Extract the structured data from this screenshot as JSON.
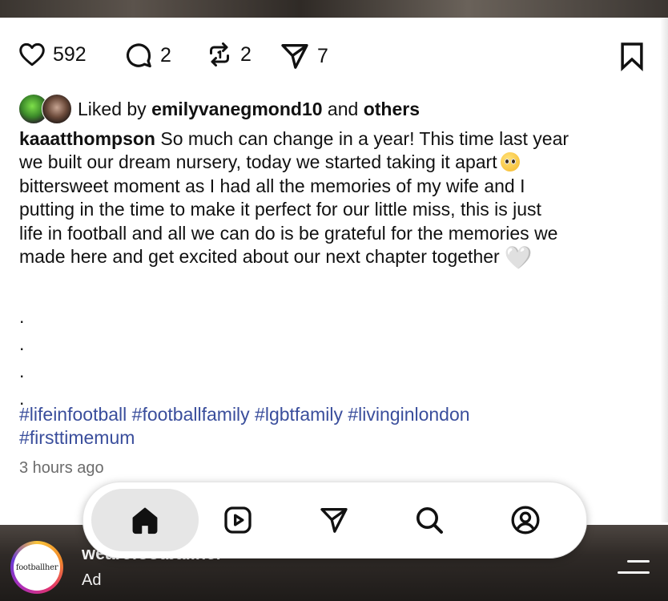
{
  "post": {
    "likes_count": "592",
    "comments_count": "2",
    "reposts_count": "2",
    "shares_count": "7",
    "liked_by_prefix": "Liked by",
    "liked_by_user": "emilyvanegmond10",
    "liked_by_and": "and",
    "liked_by_others": "others",
    "author": "kaaatthompson",
    "caption_line1": "So much can change in a year! This time last year",
    "caption_line2": "we built our dream nursery, today we started taking it apart",
    "caption_line3": "bittersweet moment as I had all the memories of my wife and I",
    "caption_line4": "putting in the time to make it perfect for our little miss, this is just",
    "caption_line5": "life in football and all we can do is be grateful for the memories we",
    "caption_line6": "made here and get excited about our next chapter together",
    "emoji_pleading": "pleading-face-emoji",
    "emoji_heart": "🤍",
    "dots": [
      ".",
      ".",
      ".",
      "."
    ],
    "hashtags_line1": "#lifeinfootball #footballfamily #lgbtfamily #livinginlondon",
    "hashtags_line2": "#firsttimemum",
    "timestamp": "3 hours ago"
  },
  "ad": {
    "logo_text": "footballher",
    "account_name": "wearefootballher",
    "label": "Ad"
  },
  "nav": {
    "items": [
      "home-icon",
      "reels-icon",
      "send-icon",
      "search-icon",
      "profile-icon"
    ],
    "active": "home"
  },
  "icons": {
    "like": "heart-icon",
    "comment": "comment-icon",
    "repost": "repost-icon",
    "share": "share-icon",
    "save": "bookmark-icon",
    "menu": "menu-icon"
  }
}
